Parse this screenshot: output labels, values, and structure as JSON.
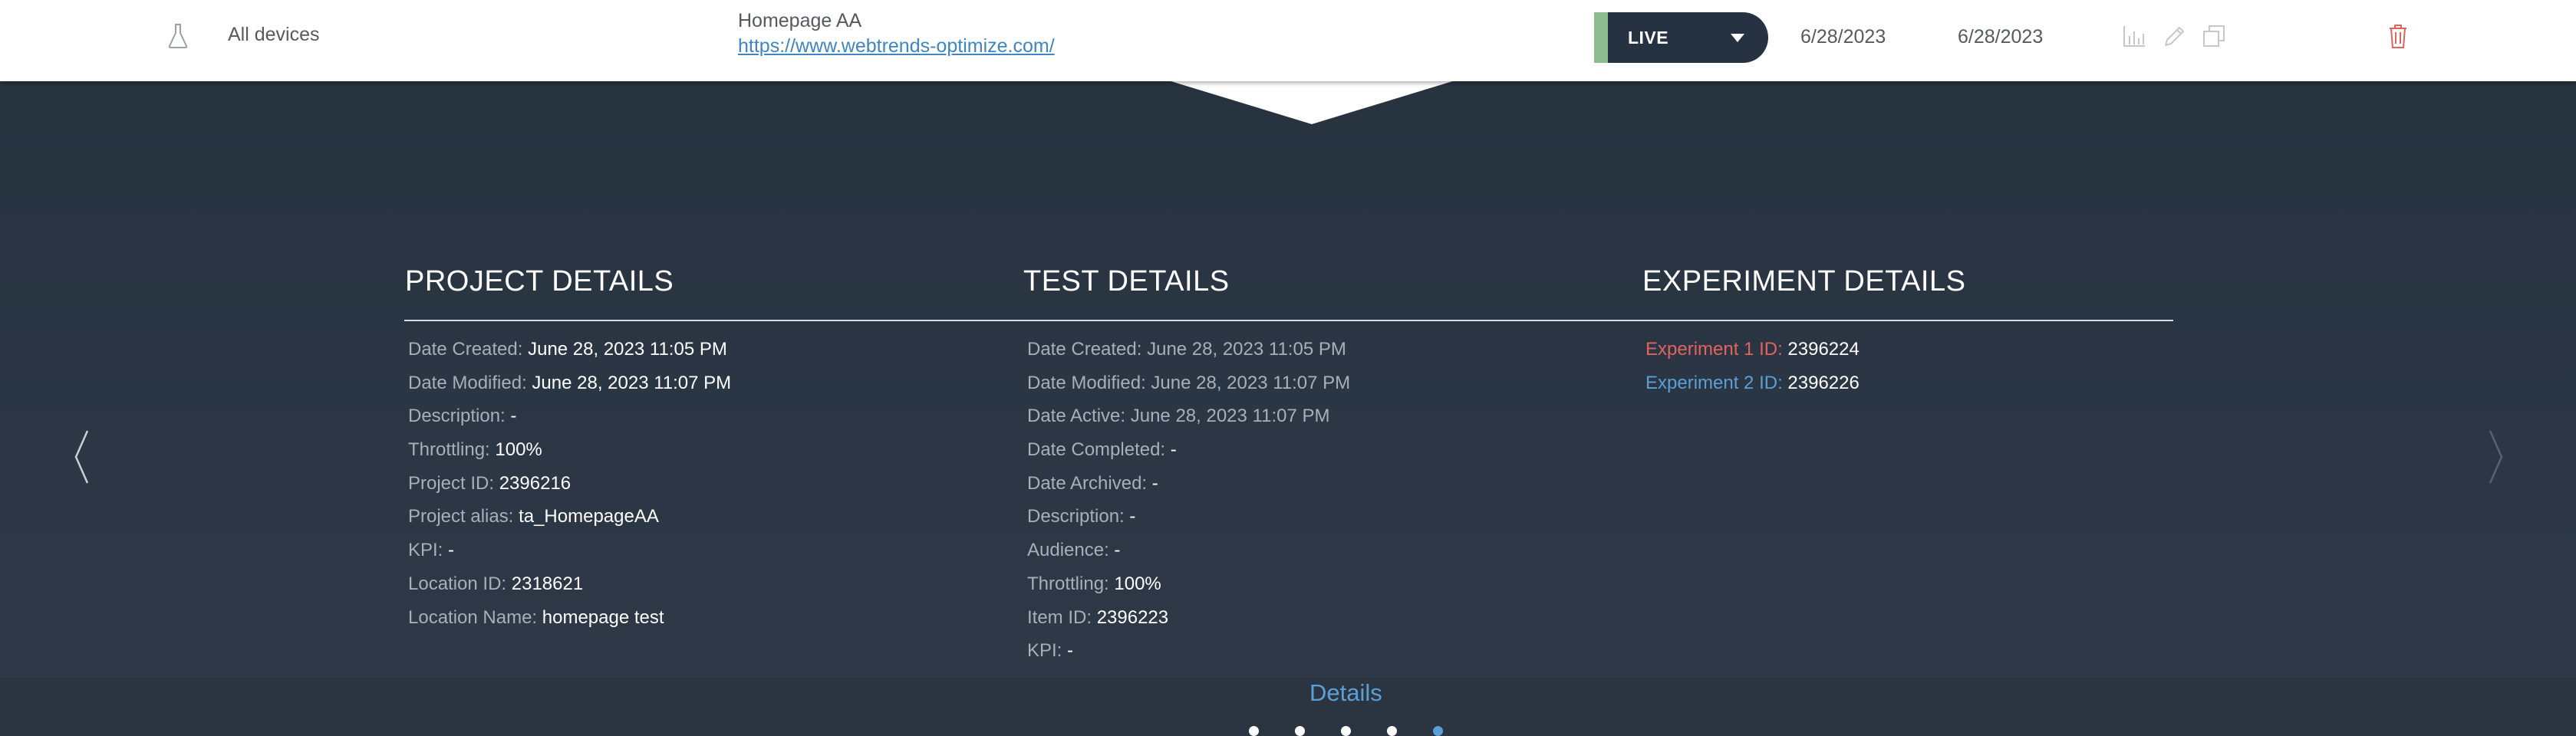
{
  "row": {
    "devices": "All devices",
    "project_name": "Homepage AA",
    "url": "https://www.webtrends-optimize.com/",
    "status": "LIVE",
    "date_start": "6/28/2023",
    "date_end": "6/28/2023"
  },
  "colors": {
    "status_bar": "#8fbc8f",
    "accent": "#5b9fd6",
    "danger": "#e0645c"
  },
  "icons": [
    "flask-icon",
    "chart-icon",
    "pencil-icon",
    "copy-icon",
    "trash-icon",
    "chevron-left-icon",
    "chevron-right-icon",
    "caret-down-icon"
  ],
  "project": {
    "title": "PROJECT DETAILS",
    "rows": [
      {
        "label": "Date Created:",
        "value": "June 28, 2023 11:05 PM"
      },
      {
        "label": "Date Modified:",
        "value": "June 28, 2023 11:07 PM"
      },
      {
        "label": "Description:",
        "value": "-"
      },
      {
        "label": "Throttling:",
        "value": "100%"
      },
      {
        "label": "Project ID:",
        "value": "2396216"
      },
      {
        "label": "Project alias:",
        "value": "ta_HomepageAA"
      },
      {
        "label": "KPI:",
        "value": "-"
      },
      {
        "label": "Location ID:",
        "value": "2318621"
      },
      {
        "label": "Location Name:",
        "value": "homepage test"
      }
    ]
  },
  "test": {
    "title": "TEST DETAILS",
    "rows": [
      {
        "label": "Date Created:",
        "value": "June 28, 2023 11:05 PM"
      },
      {
        "label": "Date Modified:",
        "value": "June 28, 2023 11:07 PM"
      },
      {
        "label": "Date Active:",
        "value": "June 28, 2023 11:07 PM"
      },
      {
        "label": "Date Completed:",
        "value": "-"
      },
      {
        "label": "Date Archived:",
        "value": "-"
      },
      {
        "label": "Description:",
        "value": "-"
      },
      {
        "label": "Audience:",
        "value": "-"
      },
      {
        "label": "Throttling:",
        "value": "100%"
      },
      {
        "label": "Item ID:",
        "value": "2396223"
      },
      {
        "label": "KPI:",
        "value": "-"
      }
    ]
  },
  "experiment": {
    "title": "EXPERIMENT DETAILS",
    "rows": [
      {
        "label": "Experiment 1 ID:",
        "value": "2396224"
      },
      {
        "label": "Experiment 2 ID:",
        "value": "2396226"
      }
    ]
  },
  "details_link": "Details",
  "pagination": {
    "count": 5,
    "active": 5
  }
}
